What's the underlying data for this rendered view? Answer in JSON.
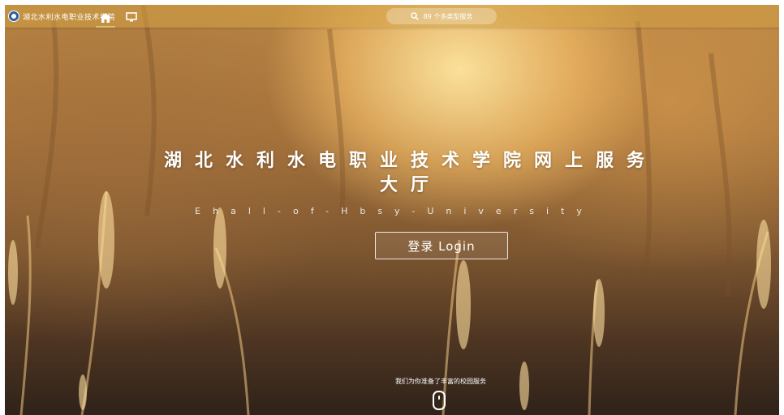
{
  "header": {
    "logo_text": "湖北水利水电职业技术学院",
    "search_placeholder": "89 个多类型服务",
    "nav": [
      {
        "name": "home",
        "icon": "home-icon"
      },
      {
        "name": "monitor",
        "icon": "monitor-icon"
      }
    ]
  },
  "hero": {
    "title_line1": "湖北水利水电职业技术学院网上服务",
    "title_line2": "大厅",
    "subtitle": "Ehall-of-Hbsy-University",
    "login_label": "登录 Login"
  },
  "footer": {
    "note": "我们为你准备了丰富的校园服务"
  },
  "colors": {
    "accent": "#d9c07a",
    "bar": "#d2a046"
  }
}
